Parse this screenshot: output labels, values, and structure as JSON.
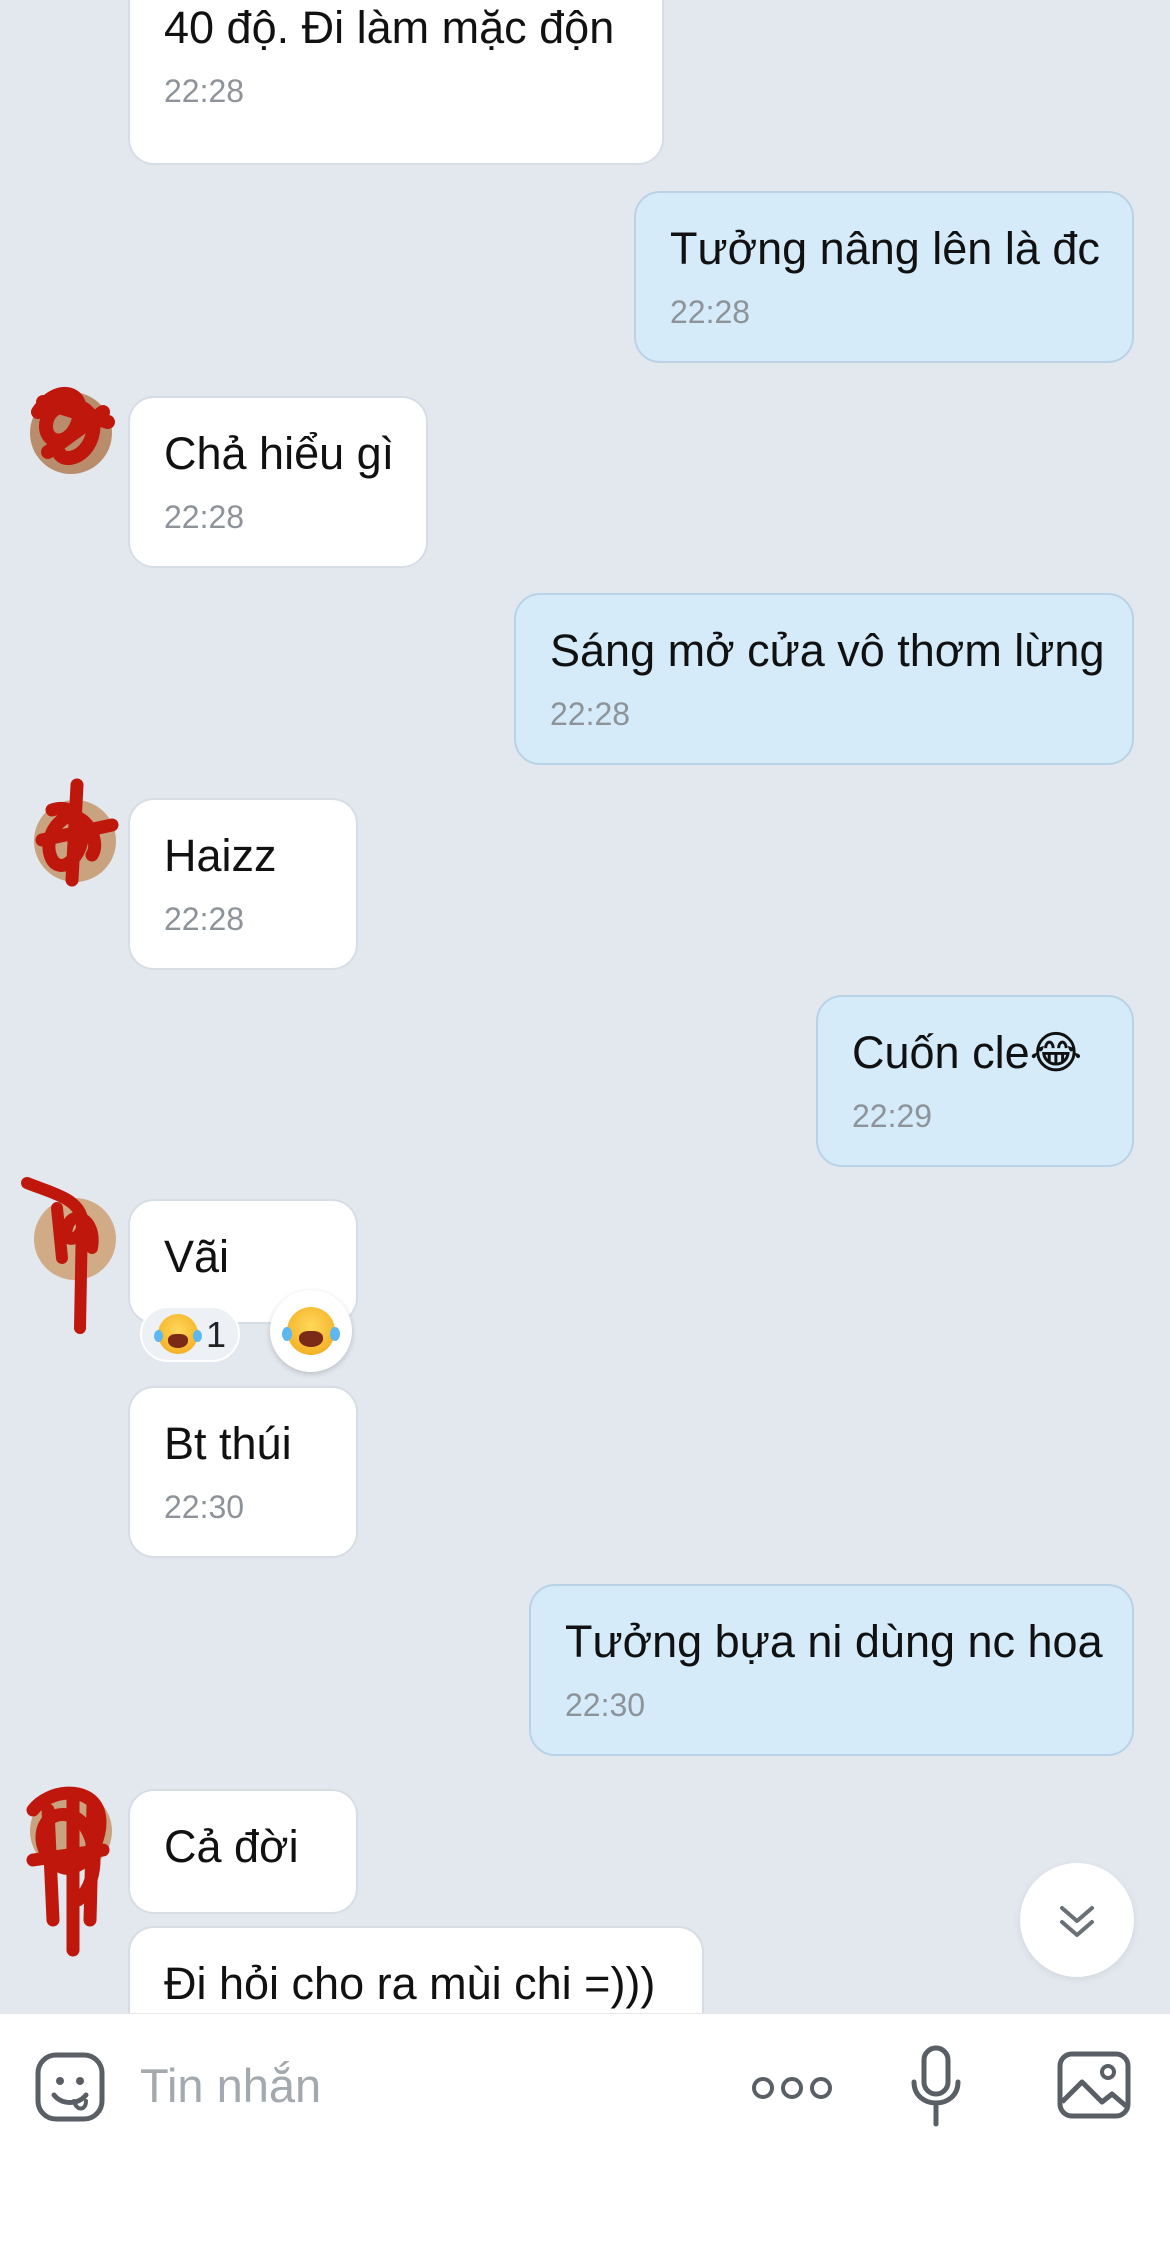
{
  "colors": {
    "chat_background": "#e3e8ef",
    "incoming_bubble": "#ffffff",
    "outgoing_bubble": "#d5ebfa",
    "timestamp": "#8d9399",
    "scribble": "#c0170c"
  },
  "messages": [
    {
      "direction": "incoming",
      "text": "40 độ. Đi làm mặc độn",
      "time": "22:28"
    },
    {
      "direction": "outgoing",
      "text": "Tưởng nâng lên là đc",
      "time": "22:28"
    },
    {
      "direction": "incoming",
      "text": "Chả hiểu gì",
      "time": "22:28"
    },
    {
      "direction": "outgoing",
      "text": "Sáng mở cửa vô thơm lừng",
      "time": "22:28"
    },
    {
      "direction": "incoming",
      "text": "Haizz",
      "time": "22:28"
    },
    {
      "direction": "outgoing",
      "text": "Cuốn cle😂",
      "time": "22:29"
    },
    {
      "direction": "incoming",
      "text": "Vãi",
      "time": "",
      "reaction": {
        "icon": "laughing-face-emoji",
        "count": "1"
      }
    },
    {
      "direction": "incoming",
      "text": "Bt thúi",
      "time": "22:30"
    },
    {
      "direction": "outgoing",
      "text": "Tưởng bựa ni dùng nc hoa",
      "time": "22:30"
    },
    {
      "direction": "incoming",
      "text": "Cả đời",
      "time": ""
    },
    {
      "direction": "incoming",
      "text": "Đi hỏi cho ra mùi chi =)))",
      "time": ""
    }
  ],
  "composer": {
    "placeholder": "Tin nhắn",
    "icons": [
      "sticker-icon",
      "more-icon",
      "microphone-icon",
      "image-icon"
    ]
  },
  "scroll_down_icon": "double-chevron-down-icon"
}
